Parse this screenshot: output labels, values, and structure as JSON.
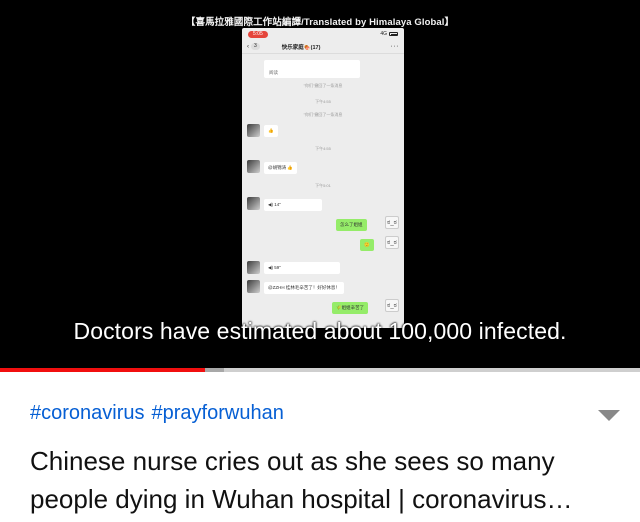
{
  "video": {
    "credit": "【喜馬拉雅國際工作站編譯/Translated by Himalaya Global】",
    "subtitle": "Doctors have estimated about 100,000 infected.",
    "progress_fraction": 0.32,
    "buffered_fraction": 0.35
  },
  "phone": {
    "status_time": "5:05",
    "status_signal": "4G",
    "back_count": "3",
    "chat_title": "快乐家庭🍖(17)",
    "more": "···",
    "messages": {
      "top_bubble": "阅读",
      "sys1": "\"你们\"撤回了一条消息",
      "sys_time1": "下午4:55",
      "sys2": "\"你们\"撤回了一条消息",
      "thumbs1": "👍",
      "sys_time2": "下午4:55",
      "mention": "@胡锦涛 👍",
      "sys_time3": "下午5:01",
      "voice1": "◀) 14\"",
      "green1": "怎么了姐姐",
      "green2": "🙂",
      "voice2": "◀) 59\"",
      "long_msg": "@ZZHH 桂林毛辛苦了！好好休息！",
      "green3": "🌾姐姐辛苦了"
    },
    "sticker": "ಠ_ಠ"
  },
  "info": {
    "hashtags": [
      "#coronavirus",
      "#prayforwuhan"
    ],
    "title": "Chinese nurse cries out as she sees so many people dying in Wuhan hospital | coronavirus…"
  },
  "colors": {
    "progress_played": "#f10f0f",
    "hashtag": "#065fd4",
    "bubble_green": "#95ec69"
  },
  "icons": {
    "expand": "chevron-down-icon"
  }
}
